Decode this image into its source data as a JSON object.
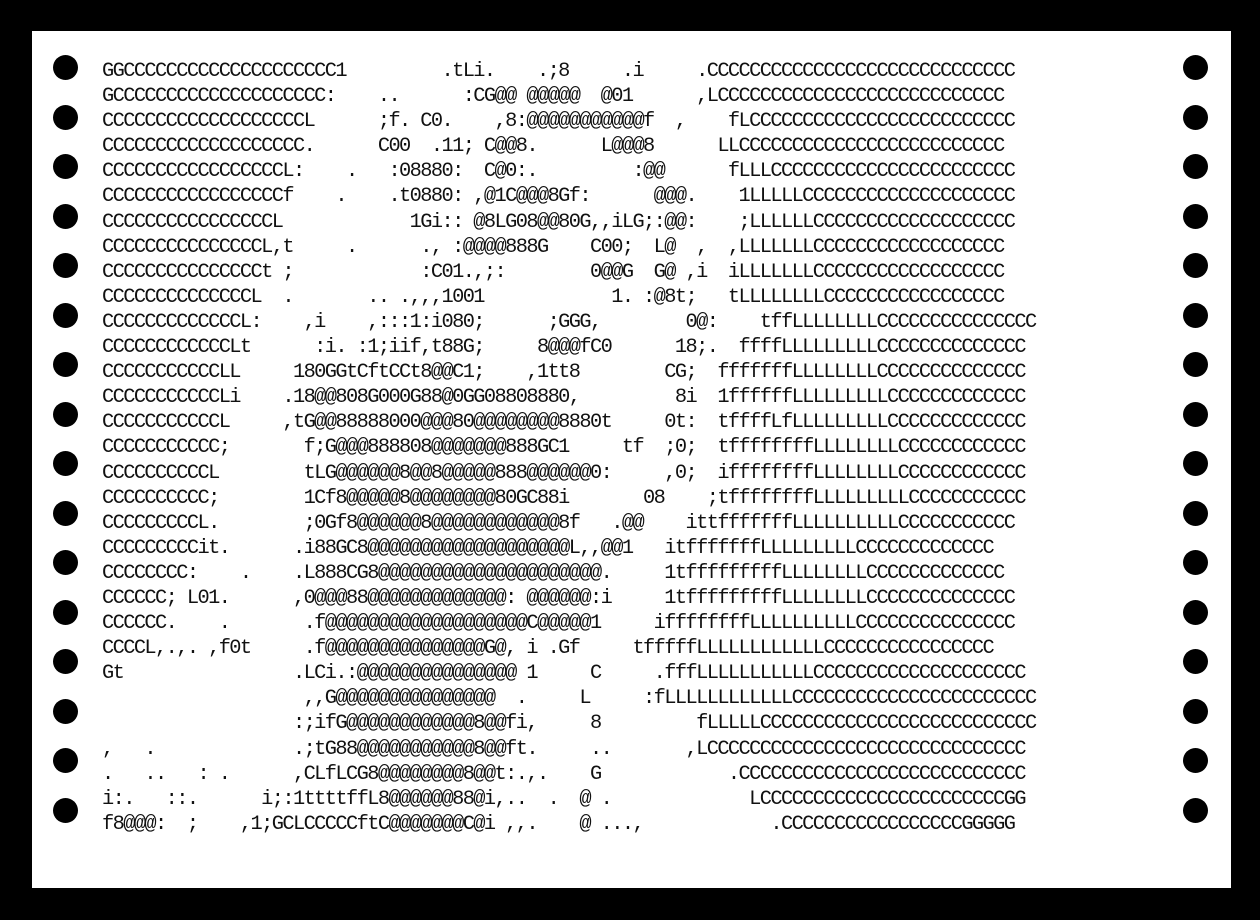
{
  "art_lines": [
    "GGCCCCCCCCCCCCCCCCCCCC1         .tLi.    .;8     .i     .CCCCCCCCCCCCCCCCCCCCCCCCCCCCC",
    "GCCCCCCCCCCCCCCCCCCCC:    ..      :CG@@ @@@@@  @01      ,LCCCCCCCCCCCCCCCCCCCCCCCCCCC",
    "CCCCCCCCCCCCCCCCCCCL      ;f. C0.    ,8:@@@@@@@@@@@f  ,    fLCCCCCCCCCCCCCCCCCCCCCCCCC",
    "CCCCCCCCCCCCCCCCCCC.      C00  .11; C@@8.      L@@@8      LLCCCCCCCCCCCCCCCCCCCCCCCCC",
    "CCCCCCCCCCCCCCCCCL:    .   :08880:  C@0:.         :@@      fLLLCCCCCCCCCCCCCCCCCCCCCCC",
    "CCCCCCCCCCCCCCCCCf    .    .t0880: ,@1C@@@8Gf:      @@@.    1LLLLLCCCCCCCCCCCCCCCCCCCC",
    "CCCCCCCCCCCCCCCCL            1Gi:: @8LG08@@80G,,iLG;:@@:    ;LLLLLLCCCCCCCCCCCCCCCCCCC",
    "CCCCCCCCCCCCCCCL,t     .      ., :@@@@888G    C00;  L@  ,  ,LLLLLLLCCCCCCCCCCCCCCCCCC",
    "CCCCCCCCCCCCCCCt ;            :C01.,;:        0@@G  G@ ,i  iLLLLLLLCCCCCCCCCCCCCCCCCC",
    "CCCCCCCCCCCCCCL  .       .. .,,,1001            1. :@8t;   tLLLLLLLLCCCCCCCCCCCCCCCCC",
    "CCCCCCCCCCCCCL:    ,i    ,:::1:i080;      ;GGG,        0@:    tffLLLLLLLLCCCCCCCCCCCCCCC",
    "CCCCCCCCCCCCLt      :i. :1;iif,t88G;     8@@@fC0      18;.  ffffLLLLLLLLLCCCCCCCCCCCCCC",
    "CCCCCCCCCCCLL     180GGtCftCCt8@@C1;    ,1tt8        CG;  fffffffLLLLLLLLCCCCCCCCCCCCCC",
    "CCCCCCCCCCCLi    .18@@808G000G88@0GG08808880,         8i  1ffffffLLLLLLLLLCCCCCCCCCCCCC",
    "CCCCCCCCCCCL     ,tG@@88888000@@@80@@@@@@@@8880t     0t:  tffffLfLLLLLLLLLCCCCCCCCCCCCC",
    "CCCCCCCCCCC;       f;G@@@888808@@@@@@@888GC1     tf  ;0;  tffffffffLLLLLLLLCCCCCCCCCCCC",
    "CCCCCCCCCCL        tLG@@@@@@8@@8@@@@@888@@@@@@0:     ,0;  iffffffffLLLLLLLLCCCCCCCCCCCC",
    "CCCCCCCCCC;        1Cf8@@@@@8@@@@@@@@80GC88i       08    ;tffffffffLLLLLLLLLCCCCCCCCCCC",
    "CCCCCCCCCL.        ;0Gf8@@@@@@8@@@@@@@@@@@@8f   .@@    ittfffffffLLLLLLLLLLCCCCCCCCCCC",
    "CCCCCCCCCit.      .i88GC8@@@@@@@@@@@@@@@@@@@L,,@@1   itfffffffLLLLLLLLLCCCCCCCCCCCCC",
    "CCCCCCCC:    .    .L888CG8@@@@@@@@@@@@@@@@@@@@@.     1tfffffffffLLLLLLLLCCCCCCCCCCCCC",
    "CCCCCC; L01.      ,0@@@88@@@@@@@@@@@@@: @@@@@@:i     1tfffffffffLLLLLLLLCCCCCCCCCCCCCC",
    "CCCCCC.    .       .f@@@@@@@@@@@@@@@@@@@C@@@@@1     iffffffffLLLLLLLLLLCCCCCCCCCCCCCCC",
    "CCCCL,.,. ,f0t     .f@@@@@@@@@@@@@@@G@, i .Gf     tfffffLLLLLLLLLLLLCCCCCCCCCCCCCCCC",
    "Gt                .LCi.:@@@@@@@@@@@@@@@ 1     C     .fffLLLLLLLLLLLCCCCCCCCCCCCCCCCCCCC",
    "                   ,,G@@@@@@@@@@@@@@@  .     L     :fLLLLLLLLLLLLCCCCCCCCCCCCCCCCCCCCCCC",
    "                  :;ifG@@@@@@@@@@@@8@@fi,     8         fLLLLLCCCCCCCCCCCCCCCCCCCCCCCCCC",
    ",   .             .;tG88@@@@@@@@@@@8@@ft.     ..       ,LCCCCCCCCCCCCCCCCCCCCCCCCCCCCCC",
    ".   ..   : .      ,CLfLCG8@@@@@@@@8@@t:.,.    G            .CCCCCCCCCCCCCCCCCCCCCCCCCCC",
    "i:.   ::.      i;:1ttttffL8@@@@@@88@i,..  .  @ .             LCCCCCCCCCCCCCCCCCCCCCCCGG",
    "f8@@@:  ;    ,1;GCLCCCCCftC@@@@@@@C@i ,,.    @ ...,            .CCCCCCCCCCCCCCCCCGGGGG"
  ],
  "colors": {
    "background": "#000000",
    "sheet": "#ffffff",
    "text": "#111111"
  }
}
